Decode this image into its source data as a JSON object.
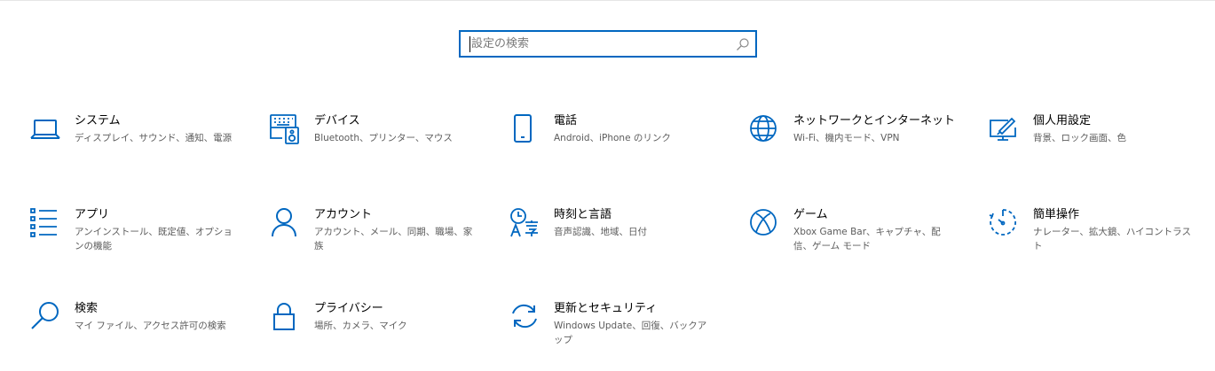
{
  "search": {
    "placeholder": "設定の検索",
    "icon": "search-icon"
  },
  "accent_color": "#0067c0",
  "tiles": [
    {
      "id": "system",
      "title": "システム",
      "desc": "ディスプレイ、サウンド、通知、電源",
      "icon": "laptop-icon"
    },
    {
      "id": "devices",
      "title": "デバイス",
      "desc": "Bluetooth、プリンター、マウス",
      "icon": "keyboard-speaker-icon"
    },
    {
      "id": "phone",
      "title": "電話",
      "desc": "Android、iPhone のリンク",
      "icon": "phone-icon"
    },
    {
      "id": "network",
      "title": "ネットワークとインターネット",
      "desc": "Wi-Fi、機内モード、VPN",
      "icon": "globe-icon"
    },
    {
      "id": "personalization",
      "title": "個人用設定",
      "desc": "背景、ロック画面、色",
      "icon": "paint-display-icon"
    },
    {
      "id": "apps",
      "title": "アプリ",
      "desc": "アンインストール、既定値、オプションの機能",
      "icon": "app-list-icon"
    },
    {
      "id": "accounts",
      "title": "アカウント",
      "desc": "アカウント、メール、同期、職場、家族",
      "icon": "person-icon"
    },
    {
      "id": "time-language",
      "title": "時刻と言語",
      "desc": "音声認識、地域、日付",
      "icon": "time-language-icon"
    },
    {
      "id": "gaming",
      "title": "ゲーム",
      "desc": "Xbox Game Bar、キャプチャ、配信、ゲーム モード",
      "icon": "xbox-icon"
    },
    {
      "id": "ease-of-access",
      "title": "簡単操作",
      "desc": "ナレーター、拡大鏡、ハイコントラスト",
      "icon": "ease-of-access-icon"
    },
    {
      "id": "search",
      "title": "検索",
      "desc": "マイ ファイル、アクセス許可の検索",
      "icon": "magnifier-icon"
    },
    {
      "id": "privacy",
      "title": "プライバシー",
      "desc": "場所、カメラ、マイク",
      "icon": "lock-icon"
    },
    {
      "id": "update-security",
      "title": "更新とセキュリティ",
      "desc": "Windows Update、回復、バックアップ",
      "icon": "sync-arrows-icon"
    }
  ]
}
